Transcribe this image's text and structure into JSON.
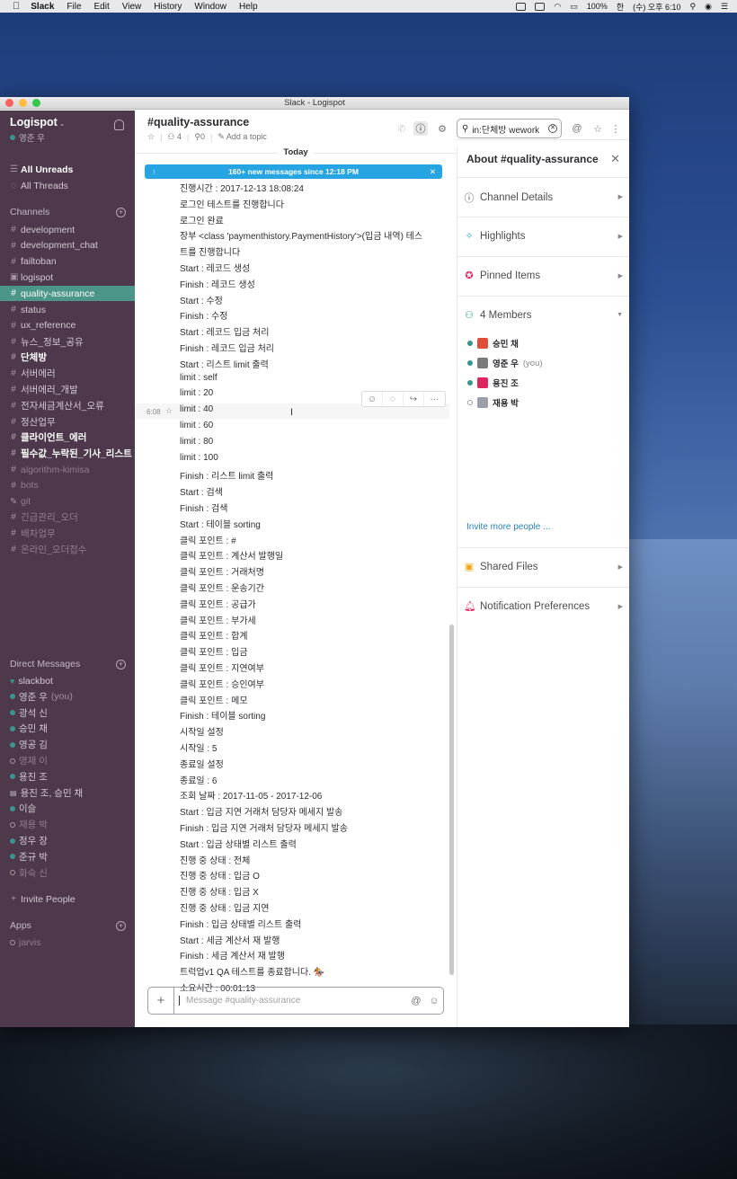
{
  "menubar": {
    "app": "Slack",
    "items": [
      "File",
      "Edit",
      "View",
      "History",
      "Window",
      "Help"
    ],
    "battery": "100%",
    "clock": "(수) 오후 6:10"
  },
  "window": {
    "title": "Slack - Logispot"
  },
  "sidebar": {
    "team": "Logispot",
    "user": "영준 우",
    "all_unreads": "All Unreads",
    "all_threads": "All Threads",
    "channels_heading": "Channels",
    "channels": [
      {
        "name": "development",
        "style": "normal",
        "prefix": "#"
      },
      {
        "name": "development_chat",
        "style": "normal",
        "prefix": "#"
      },
      {
        "name": "failtoban",
        "style": "normal",
        "prefix": "#"
      },
      {
        "name": "logispot",
        "style": "normal",
        "prefix": "🔒"
      },
      {
        "name": "quality-assurance",
        "style": "active",
        "prefix": "#"
      },
      {
        "name": "status",
        "style": "normal",
        "prefix": "#"
      },
      {
        "name": "ux_reference",
        "style": "normal",
        "prefix": "#"
      },
      {
        "name": "뉴스_정보_공유",
        "style": "normal",
        "prefix": "#"
      },
      {
        "name": "단체방",
        "style": "bold",
        "prefix": "#"
      },
      {
        "name": "서버에러",
        "style": "normal",
        "prefix": "#"
      },
      {
        "name": "서버에러_개발",
        "style": "normal",
        "prefix": "#"
      },
      {
        "name": "전자세금계산서_오류",
        "style": "normal",
        "prefix": "#"
      },
      {
        "name": "정산업무",
        "style": "normal",
        "prefix": "#"
      },
      {
        "name": "클라이언트_에러",
        "style": "bold",
        "prefix": "#"
      },
      {
        "name": "필수값_누락된_기사_리스트",
        "style": "bold",
        "prefix": "#"
      },
      {
        "name": "algorithm-kimisa",
        "style": "muted",
        "prefix": "#"
      },
      {
        "name": "bots",
        "style": "muted",
        "prefix": "#"
      },
      {
        "name": "git",
        "style": "muted",
        "prefix": "✎"
      },
      {
        "name": "긴급관리_오더",
        "style": "muted",
        "prefix": "#"
      },
      {
        "name": "배차업무",
        "style": "muted",
        "prefix": "#"
      },
      {
        "name": "온라인_오더접수",
        "style": "muted",
        "prefix": "#"
      }
    ],
    "dm_heading": "Direct Messages",
    "dms": [
      {
        "name": "slackbot",
        "status": "heart",
        "style": "normal"
      },
      {
        "name": "영준 우",
        "suffix": "(you)",
        "status": "on",
        "style": "normal"
      },
      {
        "name": "광석 신",
        "status": "on",
        "style": "normal"
      },
      {
        "name": "승민 채",
        "status": "on",
        "style": "normal"
      },
      {
        "name": "영공 김",
        "status": "on",
        "style": "normal"
      },
      {
        "name": "영재 이",
        "status": "off",
        "style": "muted"
      },
      {
        "name": "용진 조",
        "status": "on",
        "style": "normal"
      },
      {
        "name": "용진 조, 승민 채",
        "status": "group",
        "style": "normal"
      },
      {
        "name": "이슬",
        "status": "on",
        "style": "normal"
      },
      {
        "name": "재용 박",
        "status": "off",
        "style": "muted"
      },
      {
        "name": "정우 장",
        "status": "on",
        "style": "normal"
      },
      {
        "name": "준규 박",
        "status": "on",
        "style": "normal"
      },
      {
        "name": "화숙 신",
        "status": "off",
        "style": "muted"
      }
    ],
    "invite": "Invite People",
    "apps_heading": "Apps",
    "apps": [
      {
        "name": "jarvis",
        "status": "off"
      }
    ]
  },
  "channel": {
    "name": "#quality-assurance",
    "members_count": "4",
    "pins_count": "0",
    "add_topic": "Add a topic",
    "today": "Today",
    "banner": "160+ new messages since 12:18 PM",
    "hover_time": "6:08",
    "composer_placeholder": "Message #quality-assurance",
    "search_value": "in:단체방 wework",
    "messages": [
      "진행시간 : 2017-12-13 18:08:24",
      "로그인 테스트를 진행합니다",
      "로그인 완료",
      "장부 <class 'paymenthistory.PaymentHistory'>(입금 내역) 테스",
      "트를 진행합니다",
      "Start : 레코드 생성",
      "Finish : 레코드 생성",
      "Start : 수정",
      "Finish : 수정",
      "Start : 레코드 입금 처리",
      "Finish : 레코드 입금 처리",
      "Start : 리스트 limit 출력",
      "limit : self",
      "limit : 20",
      "limit : 40",
      "limit : 60",
      "limit : 80",
      "limit : 100",
      "Finish : 리스트 limit 출력",
      "Start : 검색",
      "Finish : 검색",
      "Start : 테이블 sorting",
      "클릭 포인트 : #",
      "클릭 포인트 : 계산서 발행일",
      "클릭 포인트 : 거래처명",
      "클릭 포인트 : 운송기간",
      "클릭 포인트 : 공급가",
      "클릭 포인트 : 부가세",
      "클릭 포인트 : 합계",
      "클릭 포인트 : 입금",
      "클릭 포인트 : 지연여부",
      "클릭 포인트 : 승인여부",
      "클릭 포인트 : 메모",
      "Finish : 테이블 sorting",
      "시작일 설정",
      "시작일 : 5",
      "종료일 설정",
      "종료일 : 6",
      "조회 날짜 : 2017-11-05 - 2017-12-06",
      "Start : 입금 지연 거래처 담당자 메세지 발송",
      "Finish : 입금 지연 거래처 담당자 메세지 발송",
      "Start : 입금 상태별 리스트 출력",
      "진행 중 상태 : 전체",
      "진행 중 상태 : 입금 O",
      "진행 중 상태 : 입금 X",
      "진행 중 상태 : 입금 지연",
      "Finish : 입금 상태별 리스트 출력",
      "Start : 세금 계산서 재 발행",
      "Finish : 세금 계산서 재 발행",
      "트럭업v1 QA 테스트를 종료합니다. 🏇",
      "소요시간 : 00:01:13"
    ]
  },
  "panel": {
    "title": "About #quality-assurance",
    "channel_details": "Channel Details",
    "highlights": "Highlights",
    "pinned": "Pinned Items",
    "members_label": "4 Members",
    "members": [
      {
        "name": "승민 채",
        "you": "",
        "status": "on",
        "color": "#e04e39"
      },
      {
        "name": "영준 우",
        "you": "(you)",
        "status": "on",
        "color": "#7a7a7a"
      },
      {
        "name": "용진 조",
        "you": "",
        "status": "on",
        "color": "#e0245e"
      },
      {
        "name": "재용 박",
        "you": "",
        "status": "off",
        "color": "#9aa0a6"
      }
    ],
    "invite": "Invite more people ...",
    "shared_files": "Shared Files",
    "notifications": "Notification Preferences"
  },
  "colors": {
    "sidebar_bg": "#4d394b",
    "active_channel": "#4c9689",
    "banner": "#27a5e3",
    "presence": "#38978d",
    "link": "#2a80b9"
  }
}
